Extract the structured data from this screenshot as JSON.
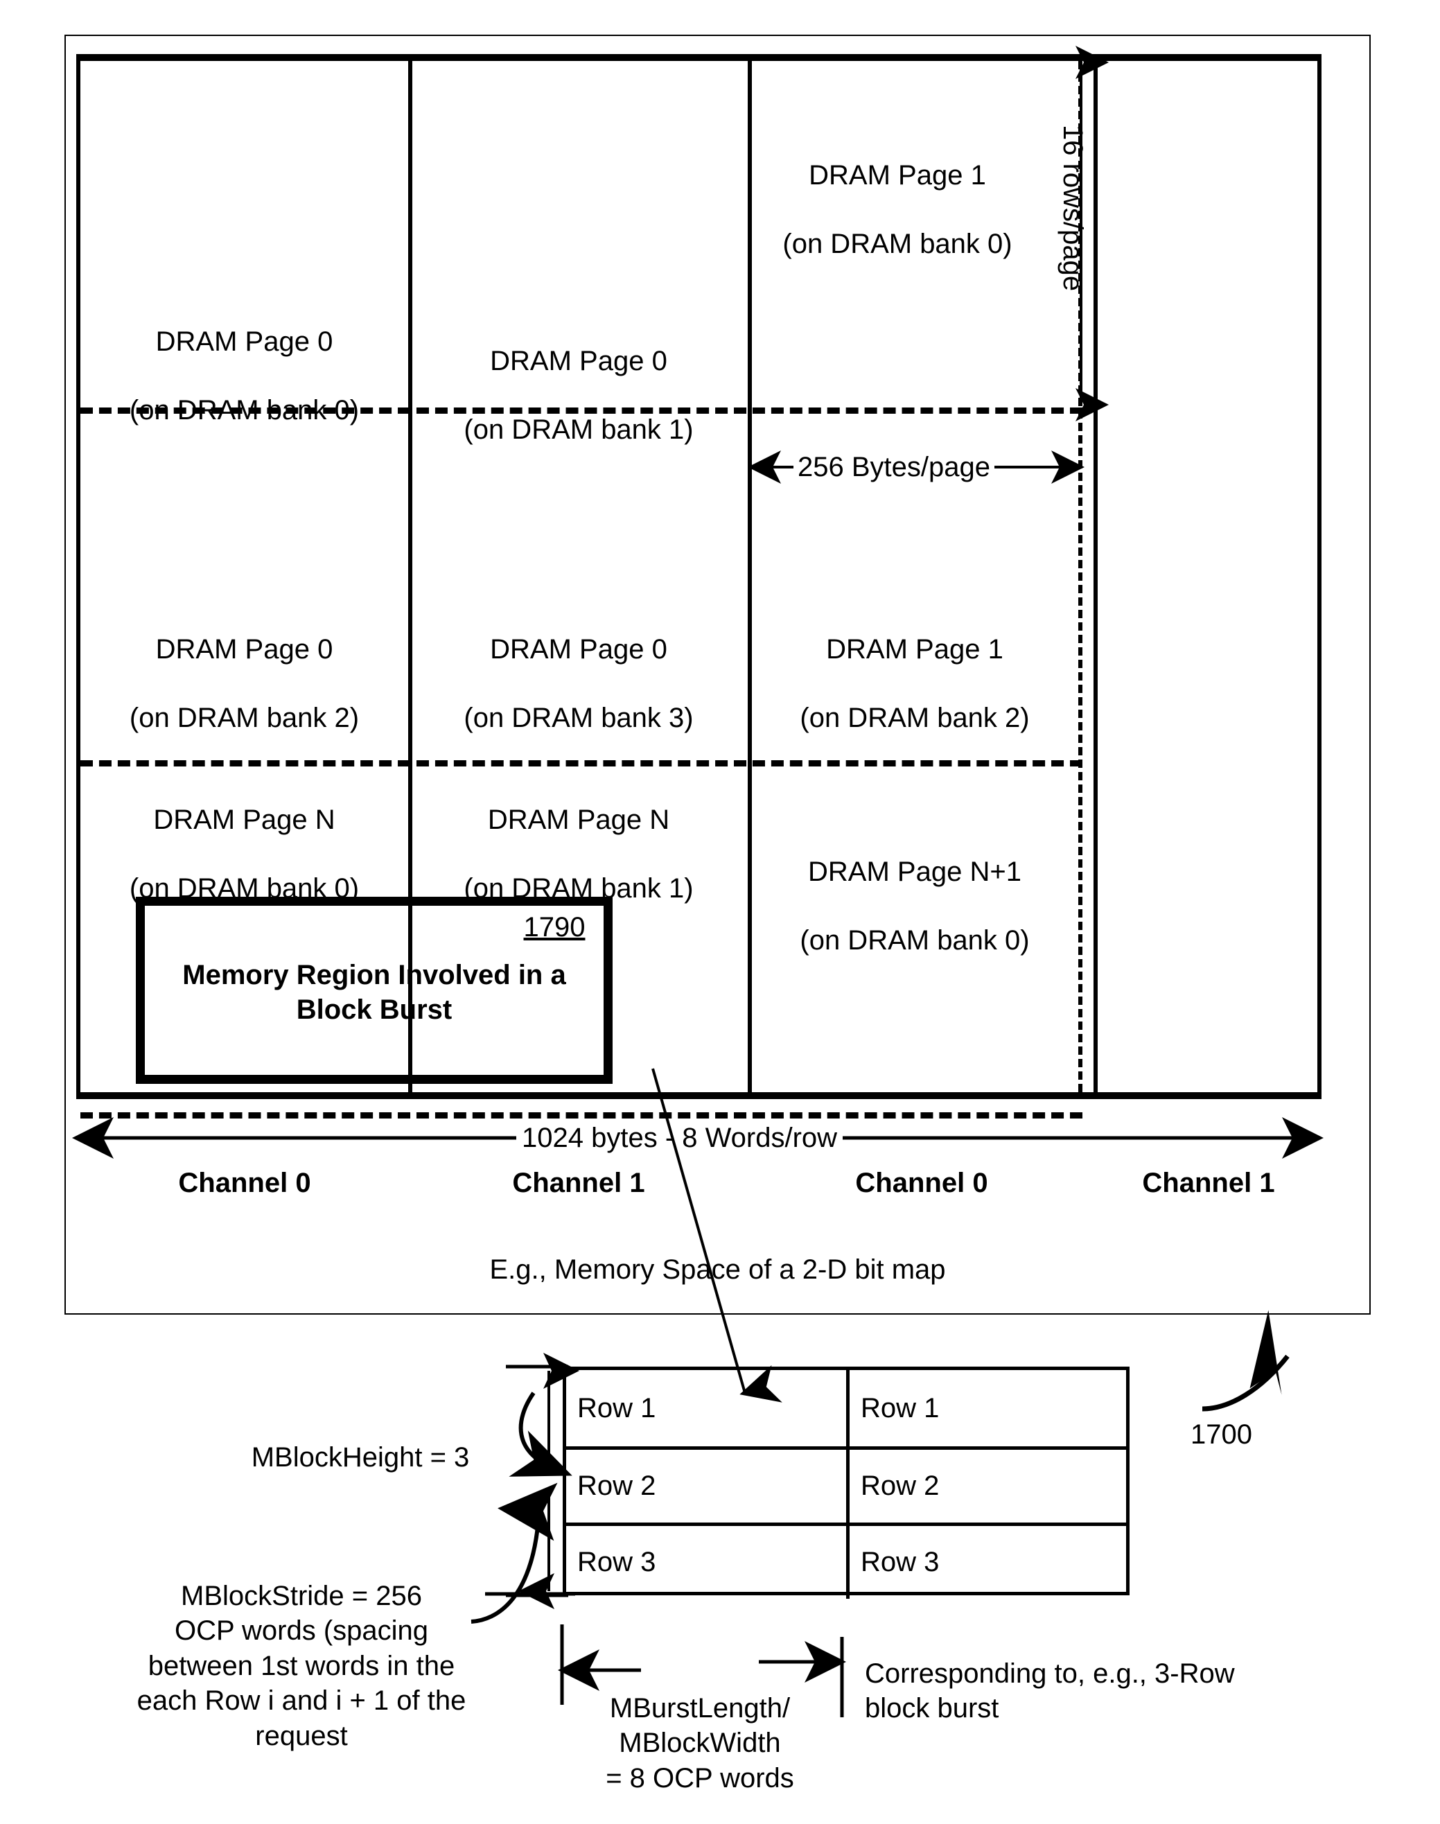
{
  "figure": {
    "ref_main": "1700",
    "ref_region": "1790",
    "caption": "E.g., Memory Space of a 2-D bit map"
  },
  "memory_map": {
    "vertical_dim_label": "16 rows/page",
    "page_width_label": "256 Bytes/page",
    "row_width_label": "1024  bytes - 8 Words/row",
    "cells": [
      {
        "page": "DRAM Page 0",
        "bank": "(on DRAM bank 0)"
      },
      {
        "page": "DRAM Page 0",
        "bank": "(on DRAM bank 1)"
      },
      {
        "page": "DRAM Page 1",
        "bank": "(on DRAM bank 0)"
      },
      {
        "page": "DRAM Page 0",
        "bank": "(on DRAM bank 2)"
      },
      {
        "page": "DRAM Page 0",
        "bank": "(on DRAM bank 3)"
      },
      {
        "page": "DRAM Page 1",
        "bank": "(on DRAM bank 2)"
      },
      {
        "page": "DRAM Page N",
        "bank": "(on DRAM bank 0)"
      },
      {
        "page": "DRAM Page N",
        "bank": "(on DRAM bank 1)"
      },
      {
        "page": "DRAM Page N+1",
        "bank": "(on DRAM bank 0)"
      }
    ],
    "channels": [
      "Channel 0",
      "Channel 1",
      "Channel 0",
      "Channel 1"
    ],
    "region_label_line1": "Memory Region Involved in a",
    "region_label_line2": "Block Burst"
  },
  "block_burst": {
    "rows_left": [
      "Row 1",
      "Row 2",
      "Row 3"
    ],
    "rows_right": [
      "Row 1",
      "Row 2",
      "Row 3"
    ],
    "block_height_label": "MBlockHeight = 3",
    "block_stride_label": "MBlockStride = 256\nOCP words (spacing\nbetween 1st words in the\neach Row i and i + 1 of the\nrequest",
    "burst_length_label": "MBurstLength/\nMBlockWidth\n= 8 OCP words",
    "corresponding_label": "Corresponding to, e.g., 3-Row\nblock burst"
  }
}
